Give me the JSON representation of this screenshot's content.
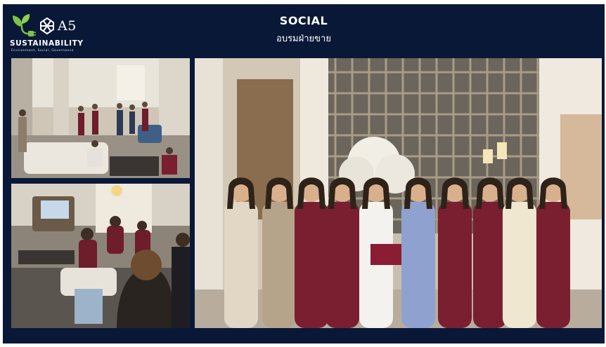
{
  "header": {
    "title": "SOCIAL",
    "subtitle": "อบรมฝ่ายขาย"
  },
  "logo": {
    "brand": "A5",
    "wordmark": "SUSTAINABILITY",
    "tagline": "Environment, Social, Governance",
    "icon_leaf": "leaf-plug-icon",
    "icon_mark": "knot-mark-icon"
  },
  "photos": [
    {
      "name": "training-session-lobby-photo"
    },
    {
      "name": "training-session-presentation-photo"
    },
    {
      "name": "sales-team-group-photo"
    }
  ],
  "colors": {
    "background": "#0a1838",
    "accent_green": "#7dc242",
    "text": "#ffffff",
    "uniform_burgundy": "#7a1f30"
  }
}
